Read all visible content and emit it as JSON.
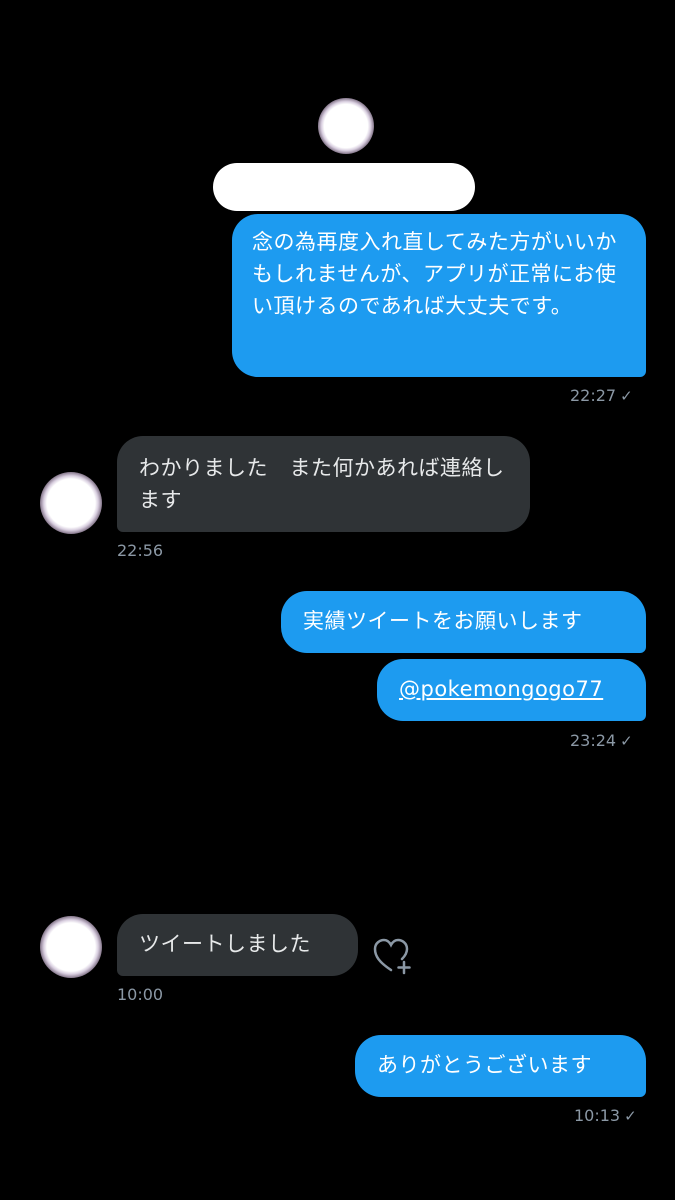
{
  "conversation": {
    "messages": [
      {
        "id": "m1",
        "direction": "outgoing",
        "text": "念の為再度入れ直してみた方がいいかもしれませんが、アプリが正常にお使い頂けるのであれば大丈夫です。"
      },
      {
        "id": "m2",
        "direction": "incoming",
        "text": "わかりました　また何かあれば連絡します"
      },
      {
        "id": "m3",
        "direction": "outgoing",
        "text": "実績ツイートをお願いします"
      },
      {
        "id": "m4",
        "direction": "outgoing",
        "text": "@pokemongogo77"
      },
      {
        "id": "m5",
        "direction": "incoming",
        "text": "ツイートしました"
      },
      {
        "id": "m6",
        "direction": "outgoing",
        "text": "ありがとうございます"
      }
    ],
    "timestamps": {
      "t1": "22:27",
      "t2": "22:56",
      "t3": "23:24",
      "t4": "10:00",
      "t5": "10:13"
    },
    "read_mark": "✓"
  },
  "icons": {
    "like": "heart-plus-icon",
    "read": "checkmark-icon",
    "avatar": "user-avatar"
  }
}
